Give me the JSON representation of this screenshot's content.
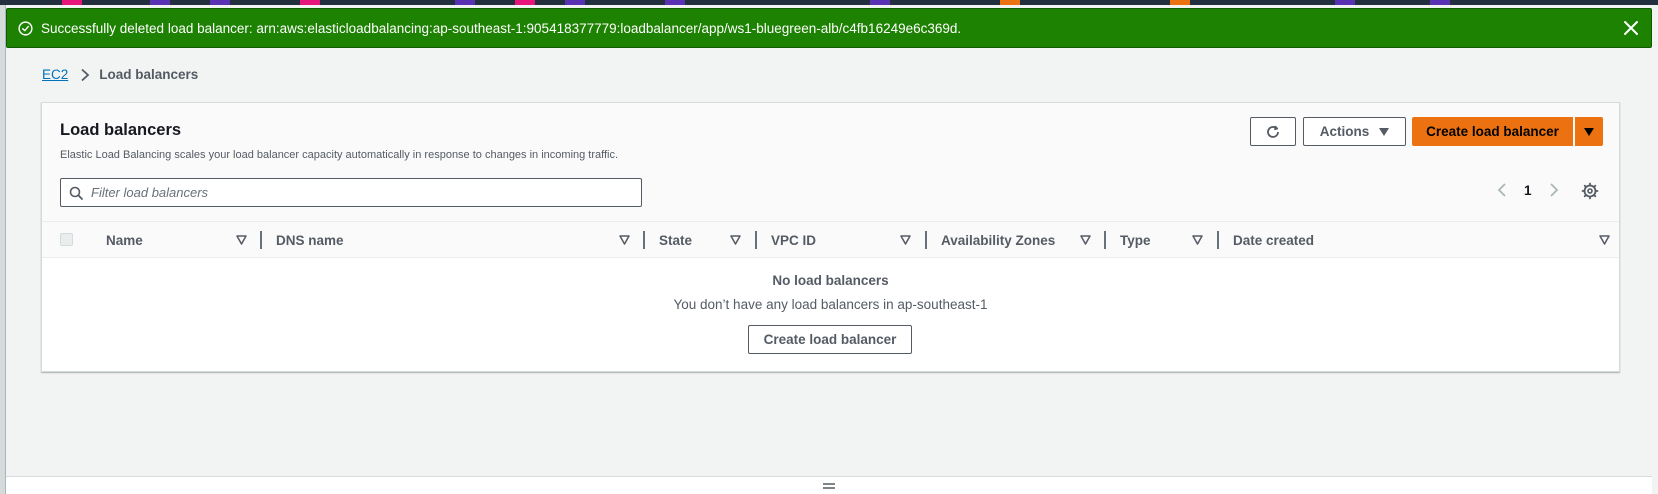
{
  "flash": {
    "message": "Successfully deleted load balancer: arn:aws:elasticloadbalancing:ap-southeast-1:905418377779:loadbalancer/app/ws1-bluegreen-alb/c4fb16249e6c369d.",
    "type": "success",
    "color": "#1d8102",
    "icon": "check-circle-icon",
    "close_icon": "close-icon"
  },
  "breadcrumb": {
    "root": "EC2",
    "current": "Load balancers"
  },
  "panel": {
    "title": "Load balancers",
    "description": "Elastic Load Balancing scales your load balancer capacity automatically in response to changes in incoming traffic.",
    "actions_label": "Actions",
    "create_label": "Create load balancer",
    "primary_color": "#ec7211"
  },
  "search": {
    "placeholder": "Filter load balancers",
    "value": ""
  },
  "pagination": {
    "current_page": "1"
  },
  "table": {
    "columns": [
      "Name",
      "DNS name",
      "State",
      "VPC ID",
      "Availability Zones",
      "Type",
      "Date created"
    ]
  },
  "empty_state": {
    "title": "No load balancers",
    "description": "You don’t have any load balancers in ap-southeast-1",
    "button_label": "Create load balancer"
  }
}
